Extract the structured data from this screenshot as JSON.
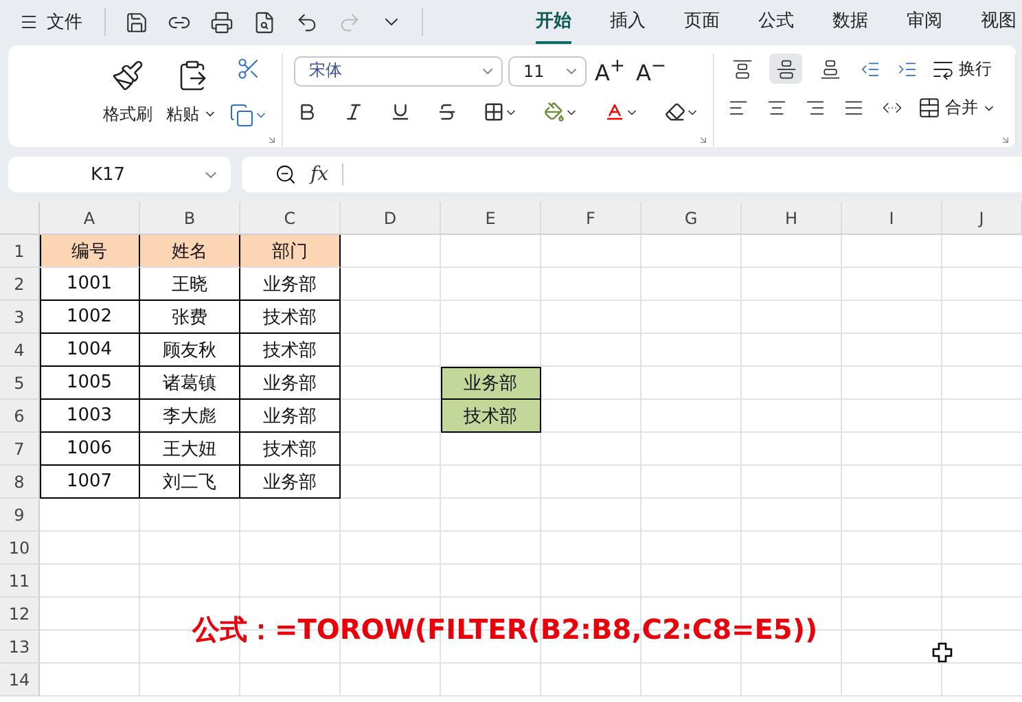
{
  "menu": {
    "label": "文件"
  },
  "tabs": [
    {
      "label": "开始",
      "selected": true
    },
    {
      "label": "插入",
      "selected": false
    },
    {
      "label": "页面",
      "selected": false
    },
    {
      "label": "公式",
      "selected": false
    },
    {
      "label": "数据",
      "selected": false
    },
    {
      "label": "审阅",
      "selected": false
    },
    {
      "label": "视图",
      "selected": false
    }
  ],
  "ribbon": {
    "format_painter": "格式刷",
    "paste": "粘贴",
    "font_name": "宋体",
    "font_size": "11",
    "grow_font": "A$^{+}$",
    "shrink_font": "A$^{−}$",
    "wrap": "换行",
    "merge": "合并",
    "vertical_align": [
      {
        "kind": "top",
        "selected": false
      },
      {
        "kind": "middle",
        "selected": true
      },
      {
        "kind": "bottom",
        "selected": false
      }
    ]
  },
  "formula_bar": {
    "name_box": "K17",
    "fx": "fx"
  },
  "sheet": {
    "columns": [
      "A",
      "B",
      "C",
      "D",
      "E",
      "F",
      "G",
      "H",
      "I",
      "J"
    ],
    "rows": [
      "1",
      "2",
      "3",
      "4",
      "5",
      "6",
      "7",
      "8",
      "9",
      "10",
      "11",
      "12",
      "13",
      "14"
    ],
    "table": {
      "headings": [
        "编号",
        "姓名",
        "部门"
      ],
      "rows": [
        [
          "1001",
          "王晓",
          "业务部"
        ],
        [
          "1002",
          "张费",
          "技术部"
        ],
        [
          "1004",
          "顾友秋",
          "技术部"
        ],
        [
          "1005",
          "诸葛镇",
          "业务部"
        ],
        [
          "1003",
          "李大彪",
          "业务部"
        ],
        [
          "1006",
          "王大妞",
          "技术部"
        ],
        [
          "1007",
          "刘二飞",
          "业务部"
        ]
      ]
    },
    "criteria": [
      "业务部",
      "技术部"
    ],
    "note": "公式：=TOROW(FILTER(B2:B8,C2:C8=E5))"
  }
}
